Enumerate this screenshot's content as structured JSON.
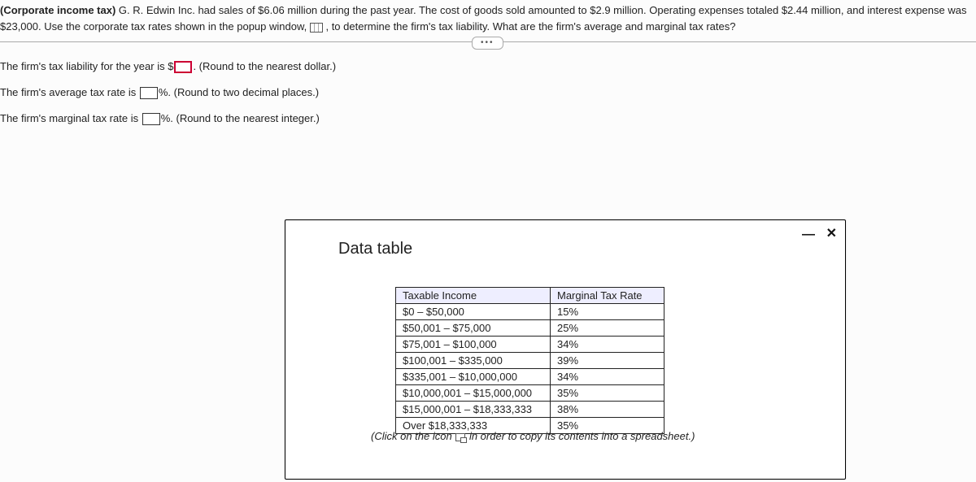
{
  "problem": {
    "title": "(Corporate income tax)",
    "body_a": " G. R. Edwin Inc. had sales of $6.06 million during the past year. The cost of goods sold amounted to $2.9 million. Operating expenses totaled $2.44 million, and interest expense was $23,000. Use the corporate tax rates shown in the popup window, ",
    "body_b": " , to determine the firm's tax liability. What are the firm's average and marginal tax rates?"
  },
  "ellipsis": "•••",
  "answers": {
    "liability_a": "The firm's tax liability for the year is $",
    "liability_b": ". (Round to the nearest dollar.)",
    "average_a": "The firm's average tax rate is ",
    "average_b": "%. (Round to two decimal places.)",
    "marginal_a": "The firm's marginal tax rate is ",
    "marginal_b": "%. (Round to the nearest integer.)"
  },
  "modal": {
    "title": "Data table",
    "minimize": "—",
    "close": "✕",
    "click_note_a": "(Click on the icon ",
    "click_note_b": " in order to copy its contents into a spreadsheet.)"
  },
  "chart_data": {
    "type": "table",
    "headers": [
      "Taxable Income",
      "Marginal Tax Rate"
    ],
    "rows": [
      {
        "income": "$0 – $50,000",
        "rate": "15%"
      },
      {
        "income": "$50,001 – $75,000",
        "rate": "25%"
      },
      {
        "income": "$75,001 – $100,000",
        "rate": "34%"
      },
      {
        "income": "$100,001 – $335,000",
        "rate": "39%"
      },
      {
        "income": "$335,001 – $10,000,000",
        "rate": "34%"
      },
      {
        "income": "$10,000,001 – $15,000,000",
        "rate": "35%"
      },
      {
        "income": "$15,000,001 – $18,333,333",
        "rate": "38%"
      },
      {
        "income": "Over $18,333,333",
        "rate": "35%"
      }
    ]
  }
}
